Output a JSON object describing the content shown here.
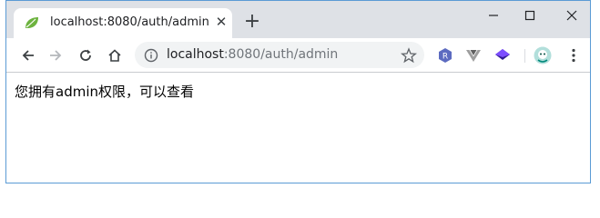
{
  "tab": {
    "title": "localhost:8080/auth/admin",
    "favicon": "spring-leaf-icon"
  },
  "window_controls": [
    "minimize-icon",
    "maximize-icon",
    "close-icon"
  ],
  "toolbar": {
    "icons": [
      "back-arrow-icon",
      "forward-arrow-icon",
      "reload-icon",
      "home-icon"
    ],
    "url_host": "localhost",
    "url_path": ":8080/auth/admin",
    "extensions": [
      "r-extension-icon",
      "vue-devtools-icon",
      "layers-extension-icon",
      "profile-avatar-icon",
      "more-menu-icon"
    ]
  },
  "page": {
    "message": "您拥有admin权限，可以查看"
  },
  "colors": {
    "tabstrip": "#dee1e6",
    "omnibox": "#f1f3f4",
    "spring_green": "#6db33f",
    "window_border": "#5b9bd5"
  }
}
